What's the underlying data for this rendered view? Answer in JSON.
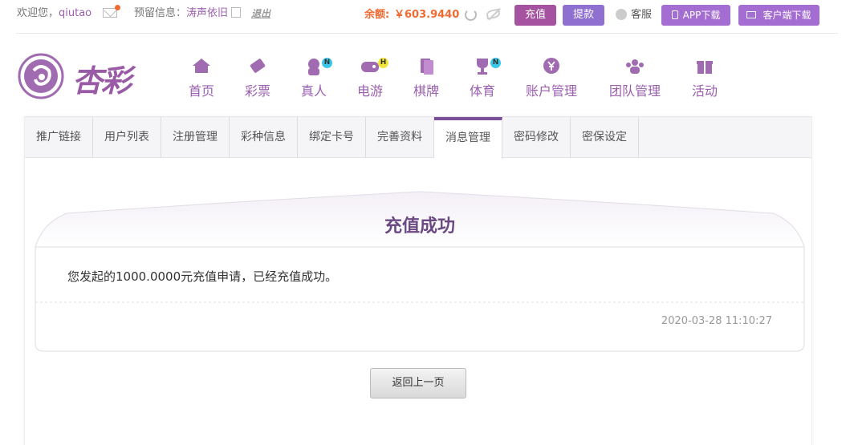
{
  "topbar": {
    "welcome": "欢迎您，",
    "username": "qiutao",
    "reserved_label": "预留信息：",
    "reserved_value": "涛声依旧",
    "logout": "退出",
    "balance_label": "余额:",
    "balance_value": "￥603.9440",
    "recharge": "充值",
    "withdraw": "提款",
    "service": "客服",
    "app_download": "APP下载",
    "client_download": "客户端下载"
  },
  "logo": {
    "text": "杏彩"
  },
  "nav": [
    {
      "label": "首页",
      "icon": "home-icon"
    },
    {
      "label": "彩票",
      "icon": "ticket-icon"
    },
    {
      "label": "真人",
      "icon": "live-dealer-icon",
      "badge": "N"
    },
    {
      "label": "电游",
      "icon": "gamepad-icon",
      "badge": "H"
    },
    {
      "label": "棋牌",
      "icon": "cards-icon"
    },
    {
      "label": "体育",
      "icon": "trophy-icon",
      "badge": "N"
    },
    {
      "label": "账户管理",
      "icon": "yen-coin-icon"
    },
    {
      "label": "团队管理",
      "icon": "team-icon"
    },
    {
      "label": "活动",
      "icon": "gift-icon"
    }
  ],
  "tabs": [
    "推广链接",
    "用户列表",
    "注册管理",
    "彩种信息",
    "绑定卡号",
    "完善资料",
    "消息管理",
    "密码修改",
    "密保设定"
  ],
  "active_tab": "消息管理",
  "message": {
    "title": "充值成功",
    "body": "您发起的1000.0000元充值申请，已经充值成功。",
    "date": "2020-03-28 11:10:27"
  },
  "back_button": "返回上一页",
  "colors": {
    "brand": "#9b5fb0",
    "accent": "#f06a32",
    "title": "#6b4a82"
  }
}
